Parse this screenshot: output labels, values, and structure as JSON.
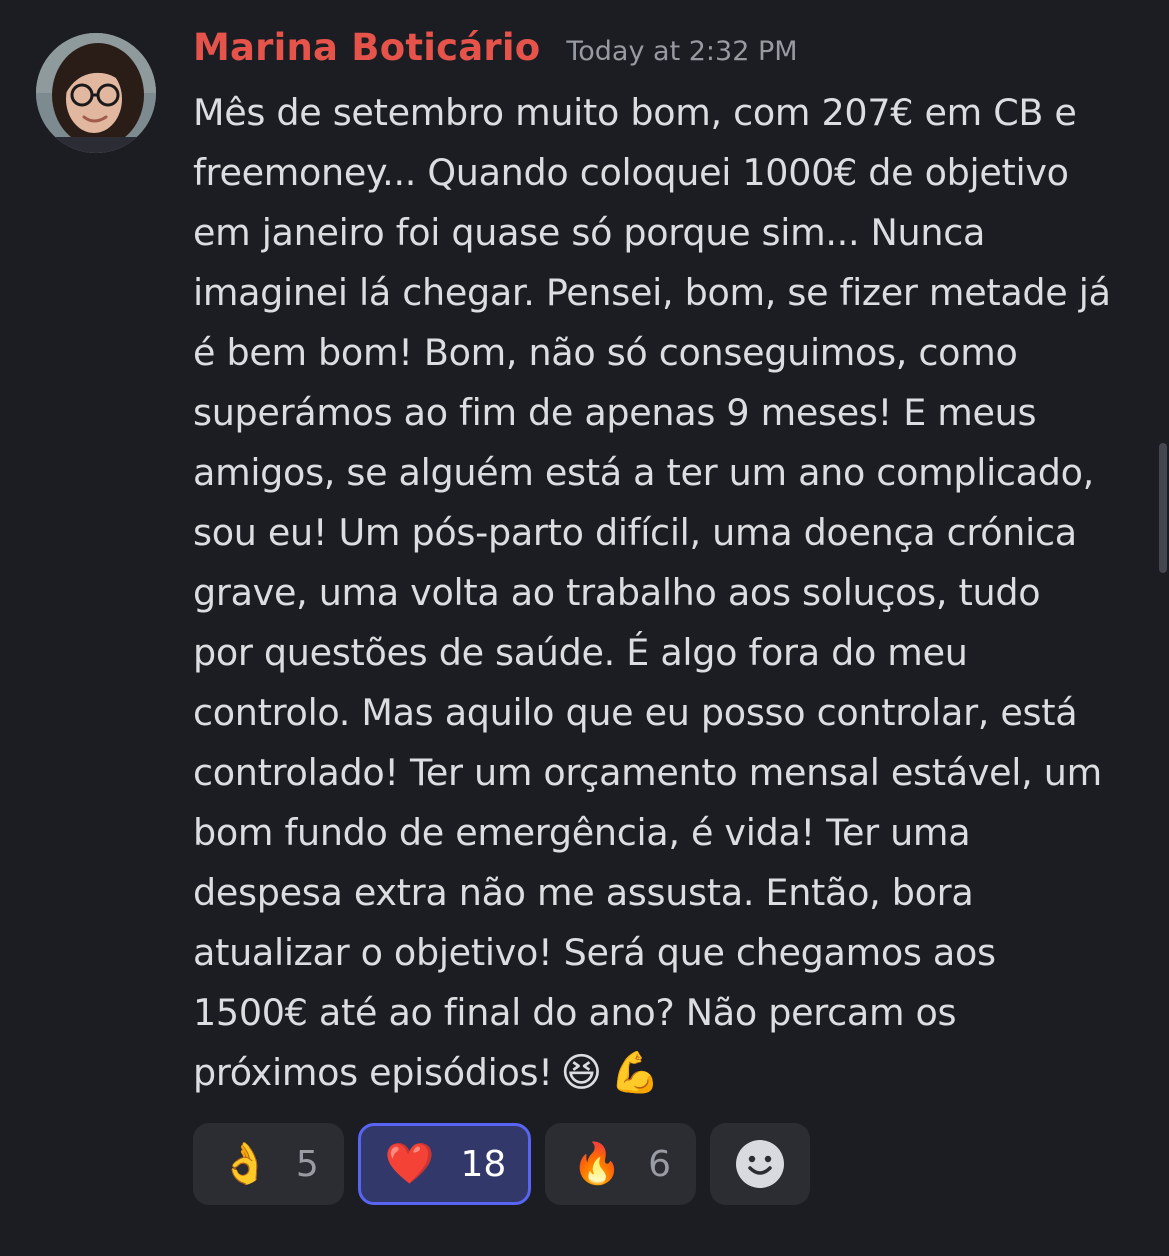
{
  "message": {
    "author": "Marina Boticário",
    "timestamp": "Today at 2:32 PM",
    "lines": [
      "Mês de setembro muito bom, com 207€ em CB e",
      "freemoney... Quando coloquei 1000€ de objetivo",
      "em janeiro foi quase só porque sim... Nunca",
      "imaginei lá chegar. Pensei, bom, se fizer metade já",
      "é bem bom! Bom, não só conseguimos, como",
      "superámos ao fim de apenas 9 meses! E meus",
      "amigos, se alguém está a ter um ano complicado,",
      "sou eu! Um pós-parto difícil, uma doença crónica",
      "grave, uma volta ao trabalho aos soluços, tudo",
      "por questões de saúde. É algo fora do meu",
      "controlo. Mas aquilo que eu posso controlar, está",
      "controlado! Ter um orçamento mensal estável, um",
      "bom fundo de emergência, é vida! Ter uma",
      "despesa extra não me assusta. Então, bora",
      "atualizar o objetivo! Será que chegamos aos",
      "1500€ até ao final do ano? Não percam os",
      "próximos episódios!"
    ],
    "trailing_emojis": [
      "😆",
      "💪"
    ]
  },
  "reactions": [
    {
      "emoji": "👌",
      "count": "5",
      "active": false
    },
    {
      "emoji": "❤️",
      "count": "18",
      "active": true
    },
    {
      "emoji": "🔥",
      "count": "6",
      "active": false
    }
  ],
  "icons": {
    "add_reaction": "smiley-face-icon",
    "avatar": "user-avatar"
  },
  "colors": {
    "background": "#1c1d22",
    "username": "#e5534b",
    "text": "#dcdde1",
    "reaction_active_border": "#5865f2"
  }
}
